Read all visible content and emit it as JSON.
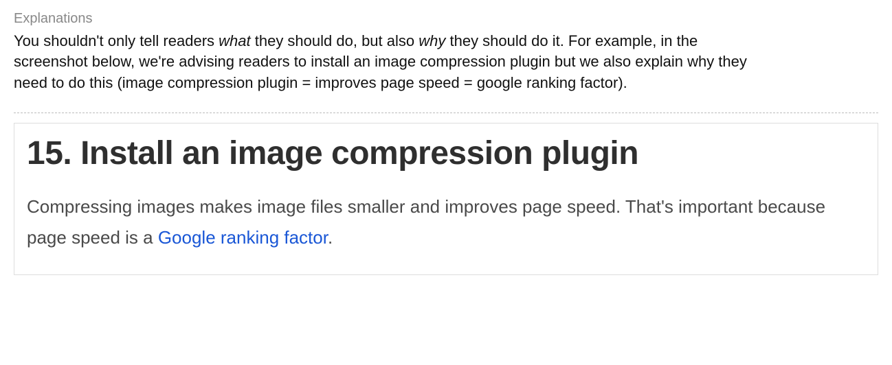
{
  "section": {
    "label": "Explanations",
    "paragraph": {
      "part1": "You shouldn't only tell readers ",
      "em1": "what",
      "part2": " they should do, but also ",
      "em2": "why",
      "part3": " they should do it. For example, in the screenshot below, we're advising readers to install an image compression plugin but we also explain why they need to do this (image compression plugin = improves page speed = google ranking factor)."
    }
  },
  "example": {
    "heading": "15. Install an image compression plugin",
    "body": {
      "part1": "Compressing images makes image files smaller and improves page speed. That's important because page speed is a ",
      "link_text": "Google ranking factor",
      "part2": "."
    }
  }
}
